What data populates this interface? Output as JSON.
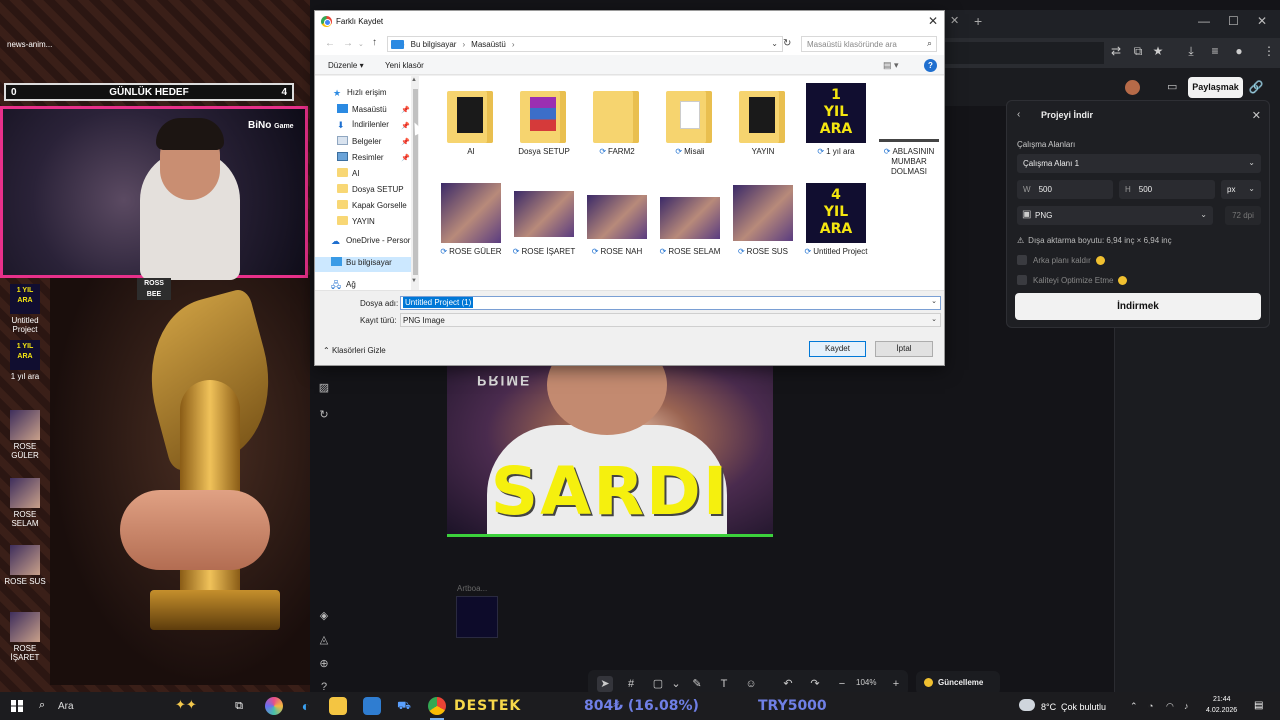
{
  "overlay": {
    "news_label": "news-anim...",
    "goal": {
      "left_count": "0",
      "title": "GÜNLÜK HEDEF",
      "right_count": "4"
    },
    "bino_text": "BiNo",
    "game_text": "Game",
    "ross_bee": "ROSS BEE",
    "side_items": [
      {
        "label": "Untitled Project",
        "thumb": "1 YIL ARA"
      },
      {
        "label": "1 yıl ara",
        "thumb": "1 YIL ARA"
      },
      {
        "label": "ROSE GÜLER",
        "thumb": ""
      },
      {
        "label": "ROSE SELAM",
        "thumb": ""
      },
      {
        "label": "ROSE SUS",
        "thumb": ""
      },
      {
        "label": "ROSE İŞARET",
        "thumb": ""
      }
    ]
  },
  "app": {
    "share_label": "Paylaşmak",
    "canvas_text": "SARDI",
    "canvas_prime": "PRIME",
    "artboard_label": "Artboa...",
    "zoom": "104%",
    "update_label": "Güncelleme"
  },
  "export_panel": {
    "title": "Projeyi İndir",
    "area_label": "Çalışma Alanları",
    "area_value": "Çalışma Alanı 1",
    "width_key": "W",
    "width_value": "500",
    "height_key": "H",
    "height_value": "500",
    "unit": "px",
    "format": "PNG",
    "dpi_placeholder": "72 dpi",
    "size_text": "Dışa aktarma boyutu: 6,94 inç × 6,94 inç",
    "remove_bg": "Arka planı kaldır",
    "optimize": "Kaliteyi Optimize Etme",
    "download_label": "İndirmek"
  },
  "dialog": {
    "title": "Farklı Kaydet",
    "breadcrumb": [
      "Bu bilgisayar",
      "Masaüstü"
    ],
    "search_placeholder": "Masaüstü klasöründe ara",
    "organize_label": "Düzenle",
    "new_folder_label": "Yeni klasör",
    "nav_items": [
      {
        "label": "Hızlı erişim",
        "icon": "star-icon",
        "pinned": false
      },
      {
        "label": "Masaüstü",
        "icon": "desktop-icon",
        "pinned": true
      },
      {
        "label": "İndirilenler",
        "icon": "download-icon",
        "pinned": true
      },
      {
        "label": "Belgeler",
        "icon": "documents-icon",
        "pinned": true
      },
      {
        "label": "Resimler",
        "icon": "pictures-icon",
        "pinned": true
      },
      {
        "label": "AI",
        "icon": "folder-icon",
        "pinned": false
      },
      {
        "label": "Dosya SETUP",
        "icon": "folder-icon",
        "pinned": false
      },
      {
        "label": "Kapak Gorselle",
        "icon": "folder-icon",
        "pinned": false
      },
      {
        "label": "YAYIN",
        "icon": "folder-icon",
        "pinned": false
      },
      {
        "label": "OneDrive - Persor",
        "icon": "cloud-icon",
        "pinned": false
      },
      {
        "label": "Bu bilgisayar",
        "icon": "computer-icon",
        "pinned": false
      },
      {
        "label": "Ağ",
        "icon": "network-icon",
        "pinned": false
      }
    ],
    "files": [
      {
        "name": "AI",
        "sync": false,
        "kind": "folder-dark"
      },
      {
        "name": "Dosya SETUP",
        "sync": false,
        "kind": "folder-winrar"
      },
      {
        "name": "FARM2",
        "sync": true,
        "kind": "folder"
      },
      {
        "name": "Misali",
        "sync": true,
        "kind": "folder-doc"
      },
      {
        "name": "YAYIN",
        "sync": false,
        "kind": "folder-dark"
      },
      {
        "name": "1 yıl ara",
        "sync": true,
        "kind": "yil",
        "thumb_top": "1",
        "thumb_mid": "YIL",
        "thumb_bot": "ARA"
      },
      {
        "name": "ABLASININ MUMBAR DOLMASI",
        "sync": true,
        "kind": "line"
      },
      {
        "name": "ROSE GÜLER",
        "sync": true,
        "kind": "image"
      },
      {
        "name": "ROSE İŞARET",
        "sync": true,
        "kind": "image"
      },
      {
        "name": "ROSE NAH",
        "sync": true,
        "kind": "image"
      },
      {
        "name": "ROSE SELAM",
        "sync": true,
        "kind": "image"
      },
      {
        "name": "ROSE SUS",
        "sync": true,
        "kind": "image"
      },
      {
        "name": "Untitled Project",
        "sync": true,
        "kind": "yil",
        "thumb_top": "4",
        "thumb_mid": "YIL",
        "thumb_bot": "ARA"
      }
    ],
    "filename_label": "Dosya adı:",
    "filename_value": "Untitled Project (1)",
    "filetype_label": "Kayıt türü:",
    "filetype_value": "PNG Image",
    "hide_folders_label": "Klasörleri Gizle",
    "save_label": "Kaydet",
    "cancel_label": "İptal"
  },
  "taskbar": {
    "search_label": "Ara",
    "ticker_destek": "DESTEK",
    "ticker_price": "804₺ (16.08%)",
    "ticker_coin": "TRY5000",
    "weather_temp": "8°C",
    "weather_desc": "Çok bulutlu",
    "clock_time": "21:44",
    "clock_date": "4.02.2026"
  }
}
